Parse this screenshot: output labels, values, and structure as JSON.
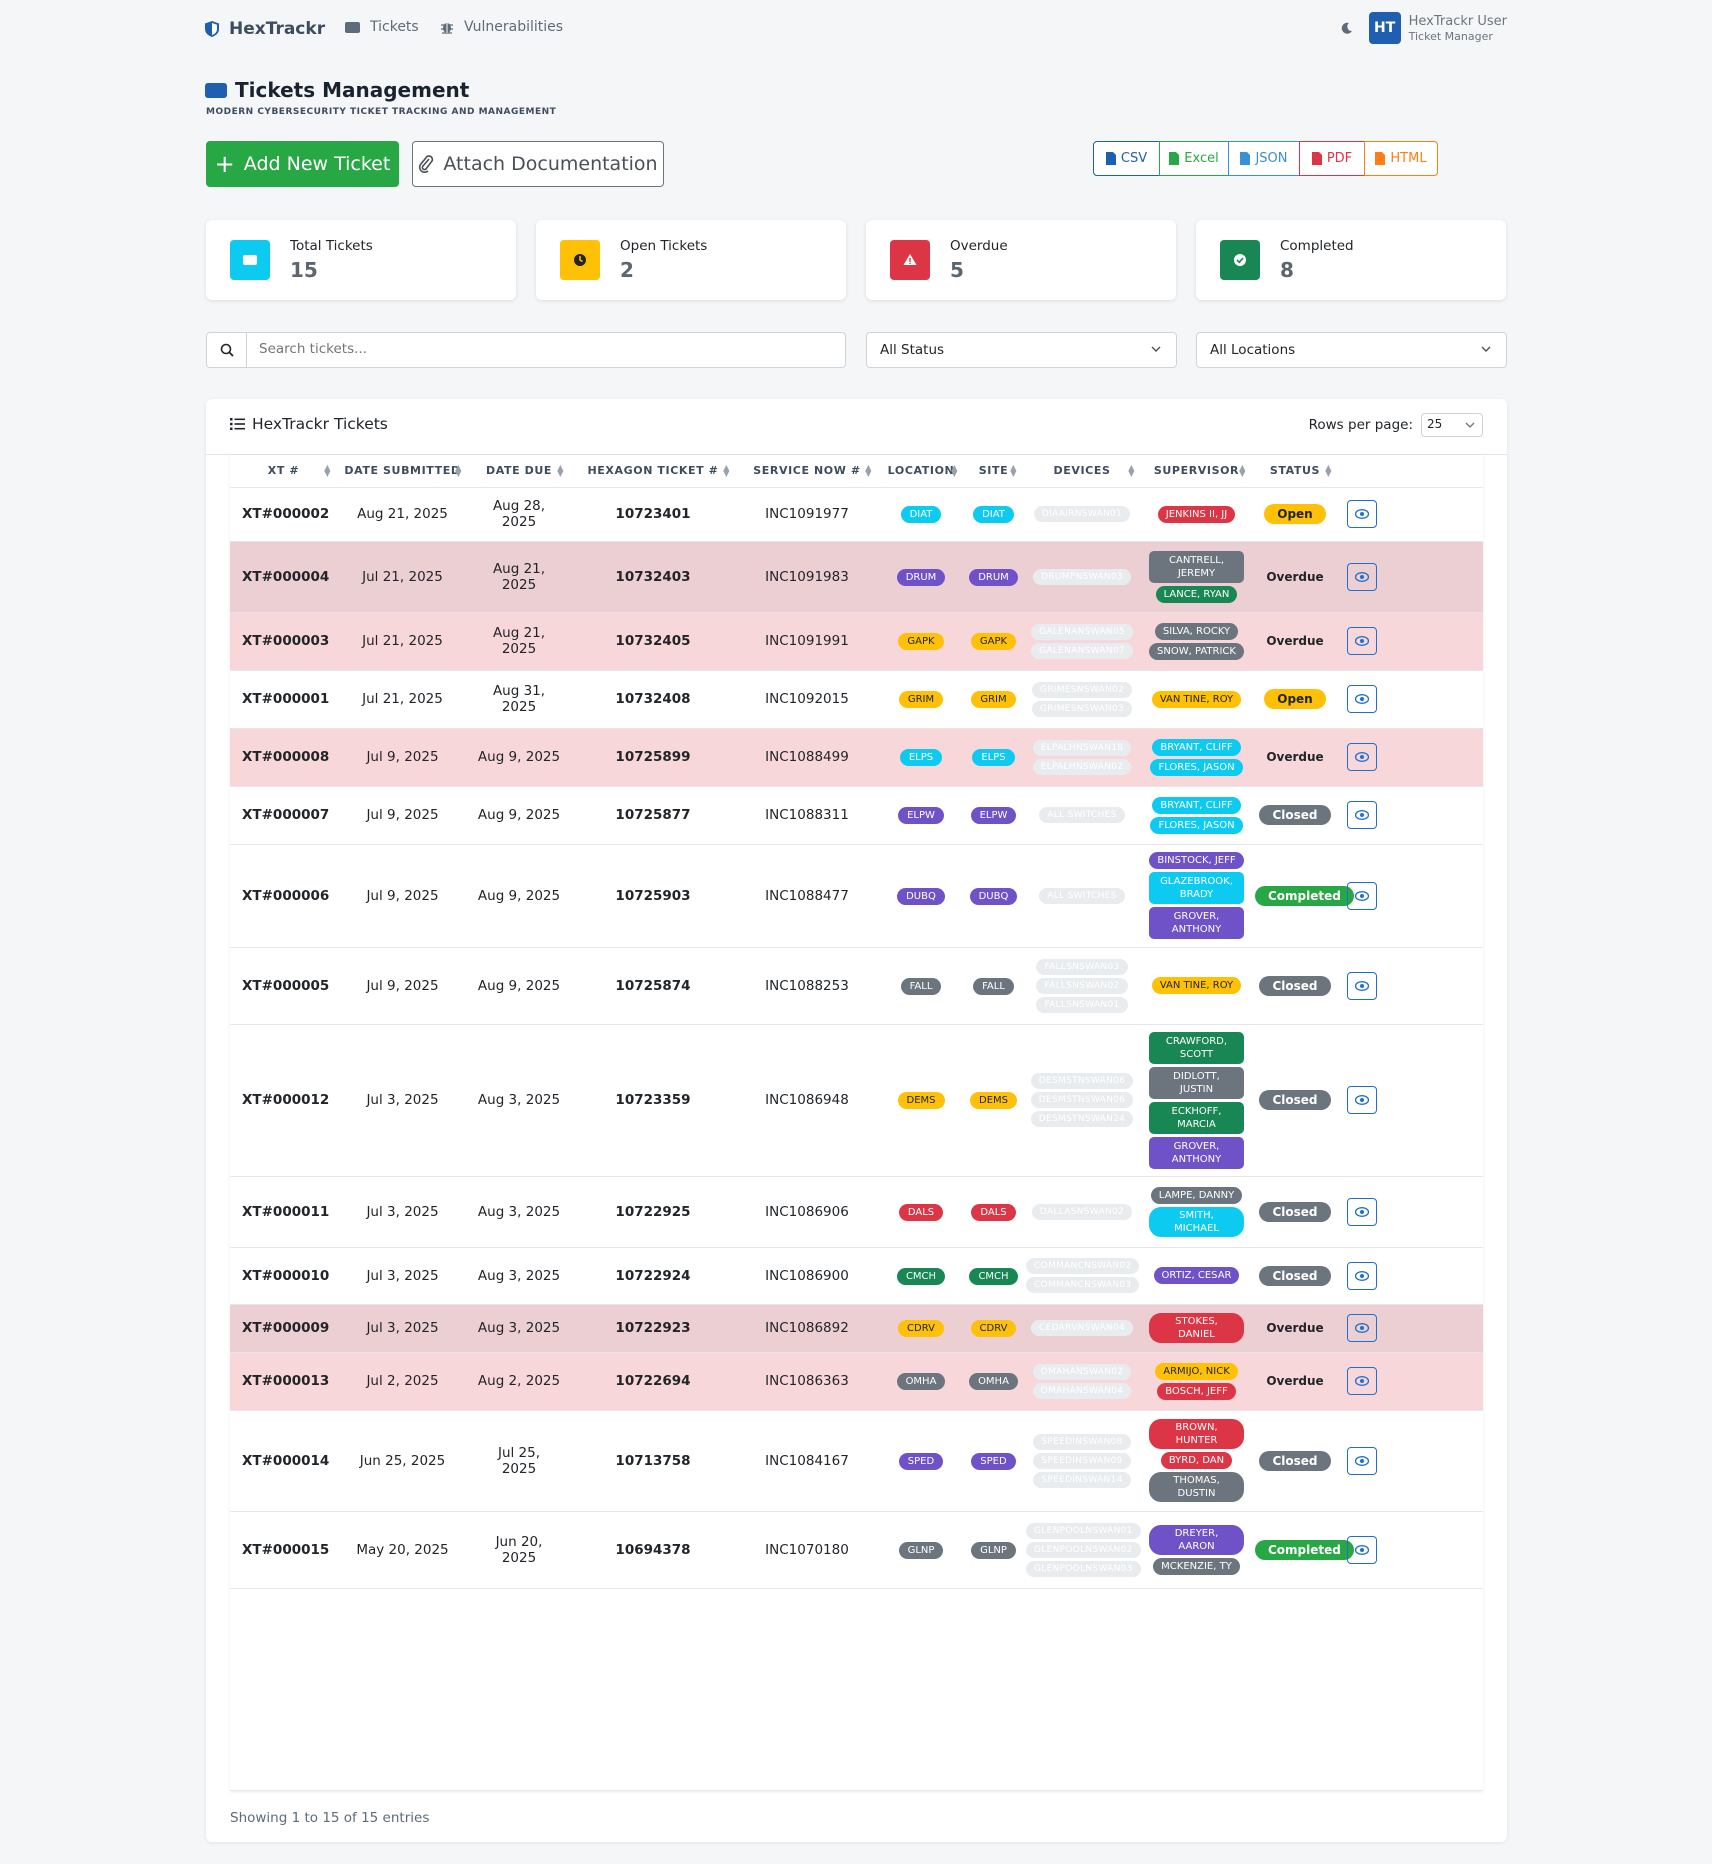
{
  "nav": {
    "brand": "HexTrackr",
    "links": [
      "Tickets",
      "Vulnerabilities"
    ],
    "user_initials": "HT",
    "user_name": "HexTrackr User",
    "user_role": "Ticket Manager"
  },
  "page": {
    "title": "Tickets Management",
    "subtitle": "MODERN CYBERSECURITY TICKET TRACKING AND MANAGEMENT",
    "add_label": "Add New Ticket",
    "attach_label": "Attach Documentation"
  },
  "export": [
    {
      "label": "CSV",
      "color": "#1f5fb2"
    },
    {
      "label": "Excel",
      "color": "#28a745"
    },
    {
      "label": "JSON",
      "color": "#3b8fd6"
    },
    {
      "label": "PDF",
      "color": "#dc3545"
    },
    {
      "label": "HTML",
      "color": "#fd7e14"
    }
  ],
  "stats": [
    {
      "label": "Total Tickets",
      "value": "15",
      "color": "#0dcaf0"
    },
    {
      "label": "Open Tickets",
      "value": "2",
      "color": "#ffc107"
    },
    {
      "label": "Overdue",
      "value": "5",
      "color": "#dc3545"
    },
    {
      "label": "Completed",
      "value": "8",
      "color": "#198754"
    }
  ],
  "filters": {
    "search_placeholder": "Search tickets...",
    "status": "All Status",
    "location": "All Locations"
  },
  "table": {
    "title": "HexTrackr Tickets",
    "rows_per_page_label": "Rows per page:",
    "rows_per_page": "25",
    "columns": [
      "XT #",
      "DATE SUBMITTED",
      "DATE DUE",
      "HEXAGON TICKET #",
      "SERVICE NOW #",
      "LOCATION",
      "SITE",
      "DEVICES",
      "SUPERVISOR",
      "STATUS"
    ],
    "rows": [
      {
        "xt": "XT#000002",
        "submitted": "Aug 21, 2025",
        "due": "Aug 28, 2025",
        "hex": "10723401",
        "sn": "INC1091977",
        "loc": "DIAT",
        "loc_color": "#0dcaf0",
        "devices": [
          "DIAAIRNSWAN01"
        ],
        "supervisors": [
          {
            "name": "JENKINS II, JJ",
            "color": "#dc3545"
          }
        ],
        "status": "Open",
        "row_bg": "#ffffff"
      },
      {
        "xt": "XT#000004",
        "submitted": "Jul 21, 2025",
        "due": "Aug 21, 2025",
        "hex": "10732403",
        "sn": "INC1091983",
        "loc": "DRUM",
        "loc_color": "#6f52c8",
        "devices": [
          "DRUMPNSWAN03"
        ],
        "supervisors": [
          {
            "name": "CANTRELL, JEREMY",
            "color": "#6c757d"
          },
          {
            "name": "LANCE, RYAN",
            "color": "#198754"
          }
        ],
        "status": "Overdue",
        "row_bg": "#eccfd2"
      },
      {
        "xt": "XT#000003",
        "submitted": "Jul 21, 2025",
        "due": "Aug 21, 2025",
        "hex": "10732405",
        "sn": "INC1091991",
        "loc": "GAPK",
        "loc_color": "#ffc107",
        "devices": [
          "GALENANSWAN05",
          "GALENANSWAN07"
        ],
        "supervisors": [
          {
            "name": "SILVA, ROCKY",
            "color": "#6c757d"
          },
          {
            "name": "SNOW, PATRICK",
            "color": "#6c757d"
          }
        ],
        "status": "Overdue",
        "row_bg": "#f8d7da"
      },
      {
        "xt": "XT#000001",
        "submitted": "Jul 21, 2025",
        "due": "Aug 31, 2025",
        "hex": "10732408",
        "sn": "INC1092015",
        "loc": "GRIM",
        "loc_color": "#ffc107",
        "devices": [
          "GRIMESNSWAN02",
          "GRIMESNSWAN03"
        ],
        "supervisors": [
          {
            "name": "VAN TINE, ROY",
            "color": "#ffc107"
          }
        ],
        "status": "Open",
        "row_bg": "#ffffff"
      },
      {
        "xt": "XT#000008",
        "submitted": "Jul 9, 2025",
        "due": "Aug 9, 2025",
        "hex": "10725899",
        "sn": "INC1088499",
        "loc": "ELPS",
        "loc_color": "#0dcaf0",
        "devices": [
          "ELPALHNSWAN18",
          "ELPALHNSWAN02"
        ],
        "supervisors": [
          {
            "name": "BRYANT, CLIFF",
            "color": "#0dcaf0"
          },
          {
            "name": "FLORES, JASON",
            "color": "#0dcaf0"
          }
        ],
        "status": "Overdue",
        "row_bg": "#f8d7da"
      },
      {
        "xt": "XT#000007",
        "submitted": "Jul 9, 2025",
        "due": "Aug 9, 2025",
        "hex": "10725877",
        "sn": "INC1088311",
        "loc": "ELPW",
        "loc_color": "#6f52c8",
        "devices": [
          "ALL SWITCHES"
        ],
        "supervisors": [
          {
            "name": "BRYANT, CLIFF",
            "color": "#0dcaf0"
          },
          {
            "name": "FLORES, JASON",
            "color": "#0dcaf0"
          }
        ],
        "status": "Closed",
        "row_bg": "#ffffff"
      },
      {
        "xt": "XT#000006",
        "submitted": "Jul 9, 2025",
        "due": "Aug 9, 2025",
        "hex": "10725903",
        "sn": "INC1088477",
        "loc": "DUBQ",
        "loc_color": "#6f52c8",
        "devices": [
          "ALL SWITCHES"
        ],
        "supervisors": [
          {
            "name": "BINSTOCK, JEFF",
            "color": "#6f52c8"
          },
          {
            "name": "GLAZEBROOK, BRADY",
            "color": "#0dcaf0"
          },
          {
            "name": "GROVER, ANTHONY",
            "color": "#6f52c8"
          }
        ],
        "status": "Completed",
        "row_bg": "#ffffff"
      },
      {
        "xt": "XT#000005",
        "submitted": "Jul 9, 2025",
        "due": "Aug 9, 2025",
        "hex": "10725874",
        "sn": "INC1088253",
        "loc": "FALL",
        "loc_color": "#6c757d",
        "devices": [
          "FALLSNSWAN03",
          "FALLSNSWAN02",
          "FALLSNSWAN01"
        ],
        "supervisors": [
          {
            "name": "VAN TINE, ROY",
            "color": "#ffc107"
          }
        ],
        "status": "Closed",
        "row_bg": "#ffffff"
      },
      {
        "xt": "XT#000012",
        "submitted": "Jul 3, 2025",
        "due": "Aug 3, 2025",
        "hex": "10723359",
        "sn": "INC1086948",
        "loc": "DEMS",
        "loc_color": "#ffc107",
        "devices": [
          "DESMSTNSWAN06",
          "DESMSTNSWAN06",
          "DESMSTNSWAN24"
        ],
        "supervisors": [
          {
            "name": "CRAWFORD, SCOTT",
            "color": "#198754"
          },
          {
            "name": "DIDLOTT, JUSTIN",
            "color": "#6c757d"
          },
          {
            "name": "ECKHOFF, MARCIA",
            "color": "#198754"
          },
          {
            "name": "GROVER, ANTHONY",
            "color": "#6f52c8"
          }
        ],
        "status": "Closed",
        "row_bg": "#ffffff"
      },
      {
        "xt": "XT#000011",
        "submitted": "Jul 3, 2025",
        "due": "Aug 3, 2025",
        "hex": "10722925",
        "sn": "INC1086906",
        "loc": "DALS",
        "loc_color": "#dc3545",
        "devices": [
          "DALLASNSWAN02"
        ],
        "supervisors": [
          {
            "name": "LAMPE, DANNY",
            "color": "#6c757d"
          },
          {
            "name": "SMITH, MICHAEL",
            "color": "#0dcaf0"
          }
        ],
        "status": "Closed",
        "row_bg": "#ffffff"
      },
      {
        "xt": "XT#000010",
        "submitted": "Jul 3, 2025",
        "due": "Aug 3, 2025",
        "hex": "10722924",
        "sn": "INC1086900",
        "loc": "CMCH",
        "loc_color": "#198754",
        "devices": [
          "COMMANCNSWAN02",
          "COMMANCNSWAN03"
        ],
        "supervisors": [
          {
            "name": "ORTIZ, CESAR",
            "color": "#6f52c8"
          }
        ],
        "status": "Closed",
        "row_bg": "#ffffff"
      },
      {
        "xt": "XT#000009",
        "submitted": "Jul 3, 2025",
        "due": "Aug 3, 2025",
        "hex": "10722923",
        "sn": "INC1086892",
        "loc": "CDRV",
        "loc_color": "#ffc107",
        "devices": [
          "CEDARVNSWAN04"
        ],
        "supervisors": [
          {
            "name": "STOKES, DANIEL",
            "color": "#dc3545"
          }
        ],
        "status": "Overdue",
        "row_bg": "#eccfd2"
      },
      {
        "xt": "XT#000013",
        "submitted": "Jul 2, 2025",
        "due": "Aug 2, 2025",
        "hex": "10722694",
        "sn": "INC1086363",
        "loc": "OMHA",
        "loc_color": "#6c757d",
        "devices": [
          "OMAHANSWAN02",
          "OMAHANSWAN04"
        ],
        "supervisors": [
          {
            "name": "ARMIJO, NICK",
            "color": "#ffc107"
          },
          {
            "name": "BOSCH, JEFF",
            "color": "#dc3545"
          }
        ],
        "status": "Overdue",
        "row_bg": "#f8d7da"
      },
      {
        "xt": "XT#000014",
        "submitted": "Jun 25, 2025",
        "due": "Jul 25, 2025",
        "hex": "10713758",
        "sn": "INC1084167",
        "loc": "SPED",
        "loc_color": "#6f52c8",
        "devices": [
          "SPEEDINSWAN08",
          "SPEEDINSWAN09",
          "SPEEDINSWAN14"
        ],
        "supervisors": [
          {
            "name": "BROWN, HUNTER",
            "color": "#dc3545"
          },
          {
            "name": "BYRD, DAN",
            "color": "#dc3545"
          },
          {
            "name": "THOMAS, DUSTIN",
            "color": "#6c757d"
          }
        ],
        "status": "Closed",
        "row_bg": "#ffffff"
      },
      {
        "xt": "XT#000015",
        "submitted": "May 20, 2025",
        "due": "Jun 20, 2025",
        "hex": "10694378",
        "sn": "INC1070180",
        "loc": "GLNP",
        "loc_color": "#6c757d",
        "devices": [
          "GLENPOOLNSWAN01",
          "GLENPOOLNSWAN02",
          "GLENPOOLNSWAN03"
        ],
        "supervisors": [
          {
            "name": "DREYER, AARON",
            "color": "#6f52c8"
          },
          {
            "name": "MCKENZIE, TY",
            "color": "#6c757d"
          }
        ],
        "status": "Completed",
        "row_bg": "#ffffff"
      }
    ]
  },
  "footer": "Showing 1 to 15 of 15 entries"
}
